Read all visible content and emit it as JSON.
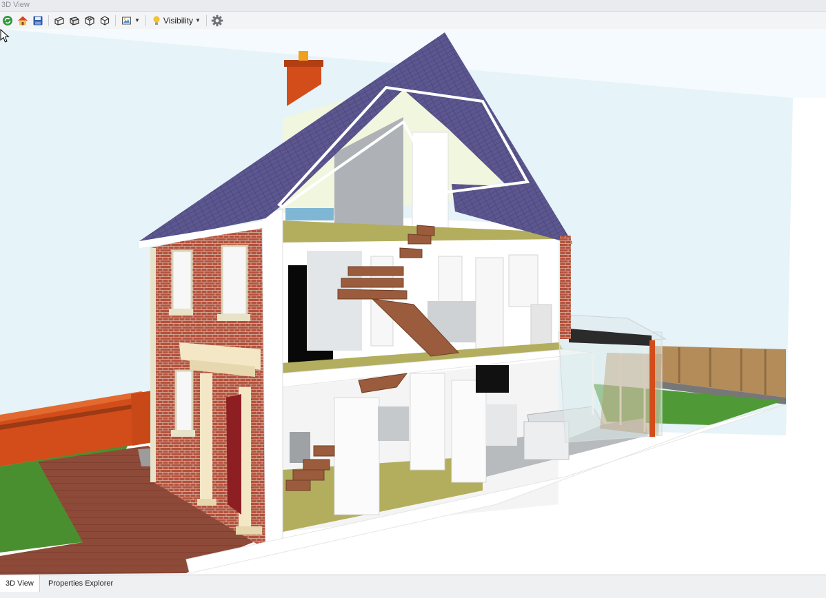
{
  "window": {
    "title": "3D View"
  },
  "toolbar": {
    "buttons": [
      {
        "icon": "refresh-icon"
      },
      {
        "icon": "home-icon"
      },
      {
        "icon": "save-icon"
      },
      {
        "icon": "view-front-icon"
      },
      {
        "icon": "view-side-icon"
      },
      {
        "icon": "view-iso-icon"
      },
      {
        "icon": "view-cube-icon"
      },
      {
        "icon": "camera-dropdown-icon"
      }
    ],
    "visibility_label": "Visibility",
    "settings_icon": "gear-icon"
  },
  "tabs": [
    {
      "label": "3D View",
      "active": true
    },
    {
      "label": "Properties Explorer",
      "active": false
    }
  ],
  "colors": {
    "roof": "#5c5790",
    "brick": "#b4523d",
    "chimney": "#d24d1a",
    "floor": "#b2ae5e",
    "stair": "#9a5c3c",
    "sky": "#e6f3f8",
    "lawn": "#4a8f2f",
    "path": "#8e4a38"
  }
}
